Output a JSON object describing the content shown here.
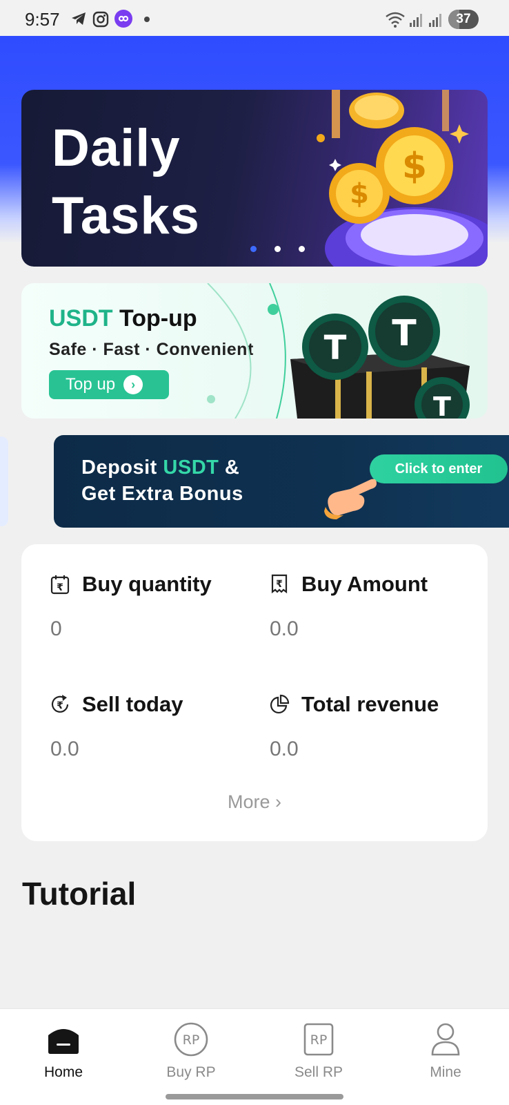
{
  "status_bar": {
    "time": "9:57",
    "battery": "37",
    "icons": [
      "telegram-icon",
      "instagram-icon",
      "app-badge-icon",
      "dot-icon",
      "wifi-icon",
      "signal-icon",
      "signal-icon"
    ]
  },
  "banners": {
    "daily": {
      "title_line1": "Daily",
      "title_line2": "Tasks",
      "slide_count": 3,
      "active_slide": 1
    },
    "topup": {
      "title_accent": "USDT",
      "title_rest": "Top-up",
      "subtitle": "Safe · Fast · Convenient",
      "button_label": "Top up"
    },
    "deposit": {
      "line1_prefix": "Deposit",
      "line1_accent": "USDT",
      "line1_suffix": "&",
      "line2": "Get Extra Bonus",
      "button_label": "Click to enter"
    }
  },
  "stats": {
    "buy_quantity": {
      "label": "Buy quantity",
      "value": "0"
    },
    "buy_amount": {
      "label": "Buy Amount",
      "value": "0.0"
    },
    "sell_today": {
      "label": "Sell today",
      "value": "0.0"
    },
    "total_revenue": {
      "label": "Total revenue",
      "value": "0.0"
    },
    "more_label": "More"
  },
  "tutorial": {
    "title": "Tutorial"
  },
  "nav": {
    "items": [
      {
        "label": "Home",
        "icon": "home-icon",
        "active": true
      },
      {
        "label": "Buy RP",
        "icon": "buy-rp-icon",
        "active": false
      },
      {
        "label": "Sell RP",
        "icon": "sell-rp-icon",
        "active": false
      },
      {
        "label": "Mine",
        "icon": "user-icon",
        "active": false
      }
    ]
  },
  "colors": {
    "brand_blue": "#3b57ff",
    "usdt_green": "#29c393",
    "deposit_navy": "#0f3150"
  }
}
